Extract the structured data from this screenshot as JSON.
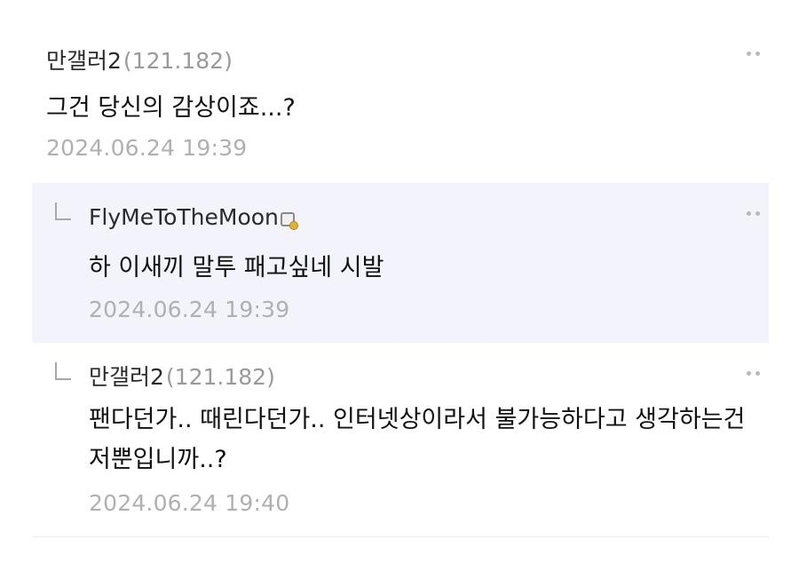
{
  "comments": [
    {
      "nick": "만갤러2",
      "ip": "121.182",
      "text": "그건 당신의 감상이죠...?",
      "date": "2024.06.24 19:39",
      "is_reply": false
    },
    {
      "nick": "FlyMeToTheMoon",
      "badge_icon": "gallery-member-icon",
      "text": "하 이새끼 말투 패고싶네 시발",
      "date": "2024.06.24 19:39",
      "is_reply": true,
      "highlight_color": "#f3f4fb"
    },
    {
      "nick": "만갤러2",
      "ip": "121.182",
      "text": "팬다던가.. 때린다던가.. 인터넷상이라서 불가능하다고 생각하는건 저뿐입니까..?",
      "date": "2024.06.24 19:40",
      "is_reply": true
    }
  ]
}
